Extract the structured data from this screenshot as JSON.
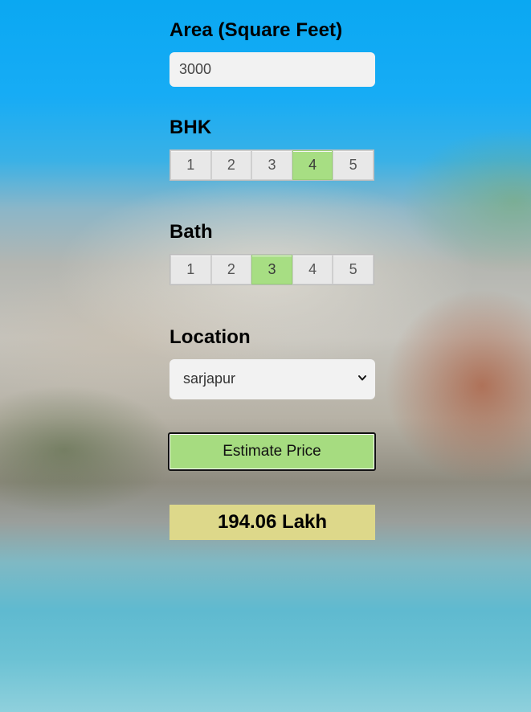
{
  "area": {
    "label": "Area (Square Feet)",
    "value": "3000"
  },
  "bhk": {
    "label": "BHK",
    "options": [
      "1",
      "2",
      "3",
      "4",
      "5"
    ],
    "selected": "4"
  },
  "bath": {
    "label": "Bath",
    "options": [
      "1",
      "2",
      "3",
      "4",
      "5"
    ],
    "selected": "3"
  },
  "location": {
    "label": "Location",
    "selected": "sarjapur"
  },
  "estimate_button": "Estimate Price",
  "result": "194.06 Lakh",
  "colors": {
    "selected": "#a7de83",
    "button": "#a6dc80",
    "result_bg": "#ddd88a"
  },
  "icons": {
    "select": "chevron-down-icon"
  }
}
